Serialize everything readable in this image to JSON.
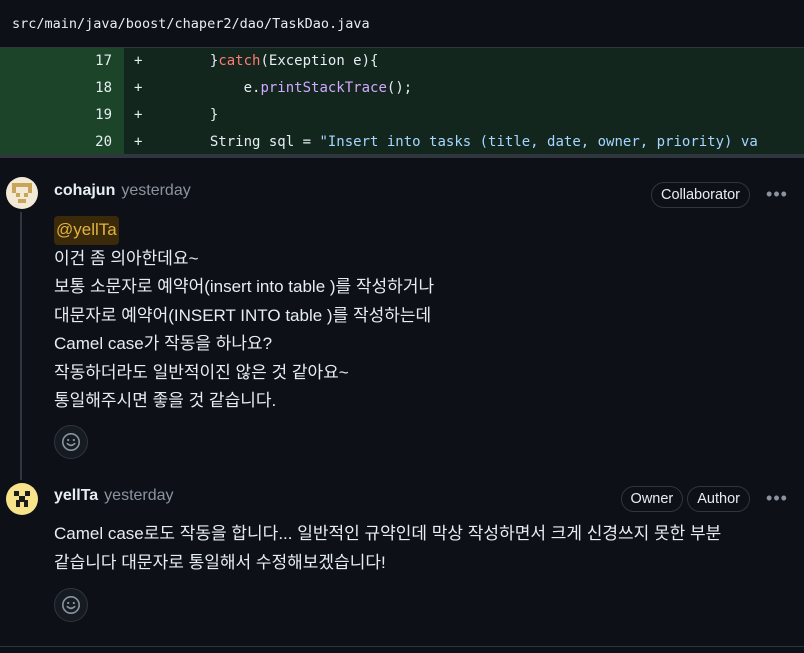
{
  "file": {
    "path": "src/main/java/boost/chaper2/dao/TaskDao.java"
  },
  "diff": {
    "lines": [
      {
        "num": "17",
        "sign": "+",
        "indent": "        ",
        "parts": [
          [
            "p",
            "}"
          ],
          [
            "kw",
            "catch"
          ],
          [
            "p",
            "(Exception e){"
          ]
        ]
      },
      {
        "num": "18",
        "sign": "+",
        "indent": "            ",
        "parts": [
          [
            "p",
            "e."
          ],
          [
            "fn",
            "printStackTrace"
          ],
          [
            "p",
            "();"
          ]
        ]
      },
      {
        "num": "19",
        "sign": "+",
        "indent": "        ",
        "parts": [
          [
            "p",
            "}"
          ]
        ]
      },
      {
        "num": "20",
        "sign": "+",
        "indent": "        ",
        "parts": [
          [
            "p",
            "String sql = "
          ],
          [
            "str",
            "\"Insert into tasks (title, date, owner, priority) va"
          ]
        ]
      }
    ]
  },
  "comments": [
    {
      "author": "cohajun",
      "time": "yesterday",
      "badges": [
        "Collaborator"
      ],
      "more": "•••",
      "mention": "@yellTa",
      "lines": [
        "이건 좀 의아한데요~",
        "보통 소문자로 예약어(insert into table )를 작성하거나",
        "대문자로 예약어(INSERT INTO table )를 작성하는데",
        "Camel case가 작동을 하나요?",
        "작동하더라도 일반적이진 않은 것 같아요~",
        "통일해주시면 좋을 것 같습니다."
      ],
      "reaction_icon": "smiley-icon"
    },
    {
      "author": "yellTa",
      "time": "yesterday",
      "badges": [
        "Owner",
        "Author"
      ],
      "more": "•••",
      "lines": [
        "Camel case로도 작동을 합니다... 일반적인 규약인데 막상 작성하면서 크게 신경쓰지 못한 부분",
        "같습니다 대문자로 통일해서 수정해보겠습니다!"
      ],
      "reaction_icon": "smiley-icon"
    }
  ],
  "colors": {
    "background": "#0d1117",
    "diff_add_line_number": "#1c4428",
    "diff_add_code": "#12261e",
    "keyword": "#ff7b72",
    "function": "#d2a8ff",
    "string": "#a5d6ff",
    "mention": "#e3b341"
  }
}
